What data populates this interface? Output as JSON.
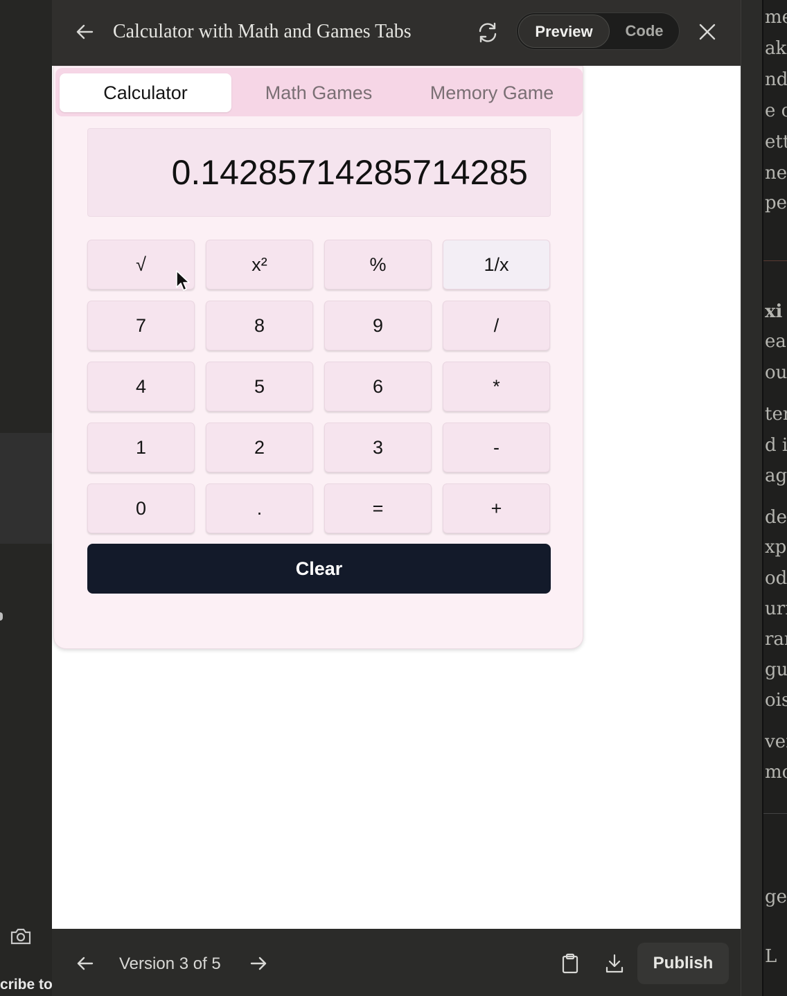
{
  "header": {
    "title": "Calculator with Math and Games Tabs",
    "view_toggle": {
      "preview_label": "Preview",
      "code_label": "Code",
      "selected": "Preview"
    },
    "icons": {
      "back": "arrow-left-icon",
      "refresh": "refresh-icon",
      "close": "close-icon"
    }
  },
  "app": {
    "tabs": [
      {
        "label": "Calculator",
        "active": true
      },
      {
        "label": "Math Games",
        "active": false
      },
      {
        "label": "Memory Game",
        "active": false
      }
    ],
    "display_value": "0.14285714285714285",
    "keys": [
      [
        "√",
        "x²",
        "%",
        "1/x"
      ],
      [
        "7",
        "8",
        "9",
        "/"
      ],
      [
        "4",
        "5",
        "6",
        "*"
      ],
      [
        "1",
        "2",
        "3",
        "-"
      ],
      [
        "0",
        ".",
        "=",
        "+"
      ]
    ],
    "clear_label": "Clear"
  },
  "footer": {
    "version_label": "Version 3 of 5",
    "publish_label": "Publish",
    "icons": {
      "prev": "arrow-left-icon",
      "next": "arrow-right-icon",
      "copy": "clipboard-icon",
      "download": "download-icon"
    }
  },
  "background": {
    "left_text": "cribe to",
    "right_fragments": [
      "me",
      "aki",
      "nd",
      "e c",
      "ett",
      "ner",
      "pen",
      "xi",
      "ead",
      "oulc",
      "ter",
      "d i",
      "ag",
      "des",
      "xpr",
      "odc",
      "urn",
      "ran",
      "gu",
      "oisc",
      "ver",
      "mo",
      "ge",
      "L"
    ]
  },
  "colors": {
    "accent_dark": "#131a2a",
    "tab_bar": "#f6d6e6",
    "card_bg": "#fcf0f5",
    "key_bg": "#f6e4ee"
  }
}
